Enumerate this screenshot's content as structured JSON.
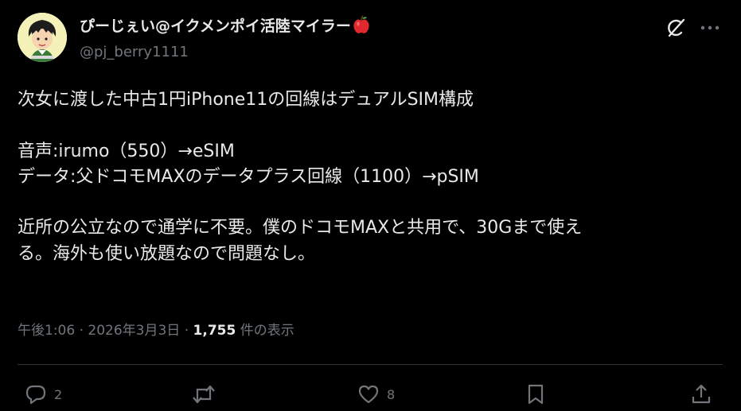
{
  "author": {
    "display_name": "ぴーじぇい@イクメンポイ活陸マイラー",
    "handle": "@pj_berry1111",
    "name_emoji": "apple-emoji"
  },
  "header_actions": {
    "grok_icon": "grok-icon",
    "more_icon": "more-icon"
  },
  "post": {
    "lines": [
      "次女に渡した中古1円iPhone11の回線はデュアルSIM構成",
      "",
      "音声:irumo（550）→eSIM",
      "データ:父ドコモMAXのデータプラス回線（1100）→pSIM",
      "",
      "近所の公立なので通学に不要。僕のドコモMAXと共用で、30Gまで使え",
      "る。海外も使い放題なので問題なし。"
    ],
    "time": "午後1:06",
    "separator": "·",
    "date": "2026年3月3日",
    "views_count": "1,755",
    "views_label": "件の表示"
  },
  "actions": {
    "reply_count": "2",
    "repost_count": "",
    "like_count": "8",
    "reply_icon": "reply-icon",
    "repost_icon": "repost-icon",
    "like_icon": "heart-icon",
    "bookmark_icon": "bookmark-icon",
    "share_icon": "share-icon"
  },
  "colors": {
    "background": "#000000",
    "text": "#e7e9ea",
    "secondary": "#71767b",
    "divider": "#2f3336"
  }
}
